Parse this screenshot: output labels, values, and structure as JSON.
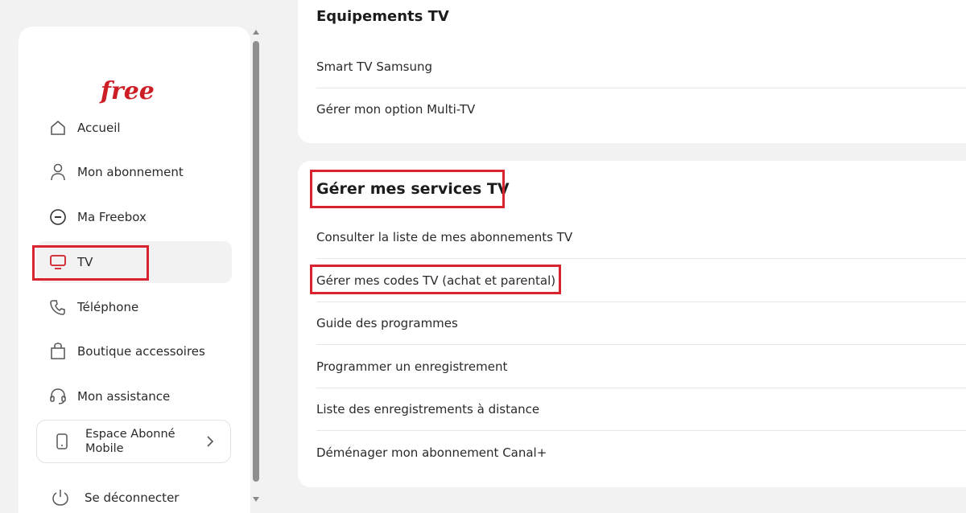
{
  "sidebar": {
    "logo_text": "free",
    "nav": [
      {
        "label": "Accueil",
        "icon": "home-icon"
      },
      {
        "label": "Mon abonnement",
        "icon": "user-icon"
      },
      {
        "label": "Ma Freebox",
        "icon": "freebox-icon"
      },
      {
        "label": "TV",
        "icon": "tv-icon",
        "active": true
      },
      {
        "label": "Téléphone",
        "icon": "phone-icon"
      },
      {
        "label": "Boutique accessoires",
        "icon": "shopping-bag-icon"
      },
      {
        "label": "Mon assistance",
        "icon": "headset-icon"
      }
    ],
    "mobile_card_label": "Espace Abonné Mobile",
    "logout_label": "Se déconnecter"
  },
  "equipements": {
    "title": "Equipements TV",
    "items": [
      "Smart TV Samsung",
      "Gérer mon option Multi-TV"
    ]
  },
  "services": {
    "title": "Gérer mes services TV",
    "items": [
      "Consulter la liste de mes abonnements TV",
      "Gérer mes codes TV (achat et parental)",
      "Guide des programmes",
      "Programmer un enregistrement",
      "Liste des enregistrements à distance",
      "Déménager mon abonnement Canal+"
    ]
  },
  "colors": {
    "brand": "#cd1e25",
    "highlight": "#d9232e"
  }
}
